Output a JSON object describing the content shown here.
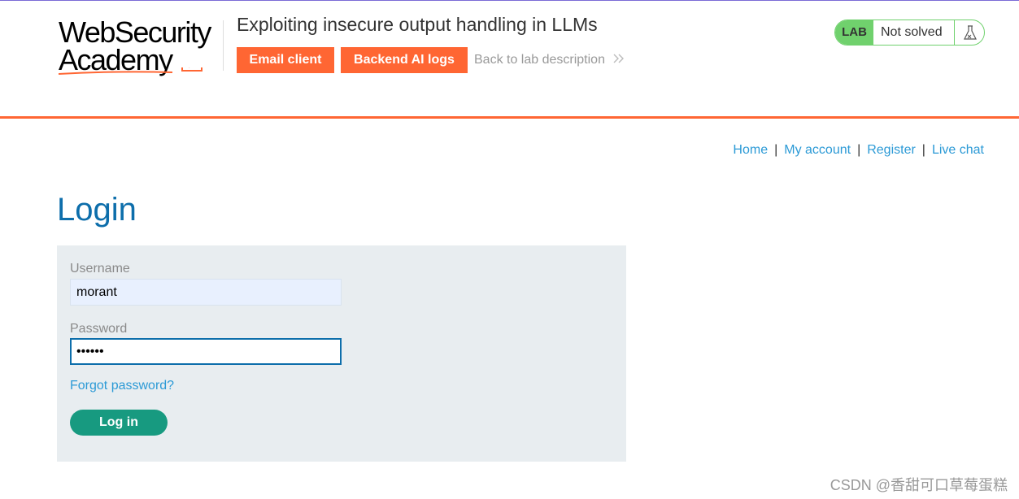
{
  "header": {
    "logo_line1": "WebSecurity",
    "logo_line2": "Academy",
    "lab_title": "Exploiting insecure output handling in LLMs",
    "email_client_label": "Email client",
    "backend_logs_label": "Backend AI logs",
    "back_link_label": "Back to lab description",
    "lab_badge": "LAB",
    "lab_status": "Not solved"
  },
  "nav": {
    "home": "Home",
    "my_account": "My account",
    "register": "Register",
    "live_chat": "Live chat",
    "separator": "|"
  },
  "page": {
    "title": "Login"
  },
  "form": {
    "username_label": "Username",
    "username_value": "morant",
    "password_label": "Password",
    "password_value": "••••••",
    "forgot_label": "Forgot password?",
    "login_label": "Log in"
  },
  "watermark": "CSDN @香甜可口草莓蛋糕",
  "colors": {
    "orange": "#ff6633",
    "lab_green": "#70d16d",
    "link_blue": "#2c9ad6",
    "title_blue": "#0d6eab",
    "button_green": "#179a80"
  },
  "icons": {
    "back": "double-chevron-right-icon",
    "lab": "flask-icon"
  }
}
